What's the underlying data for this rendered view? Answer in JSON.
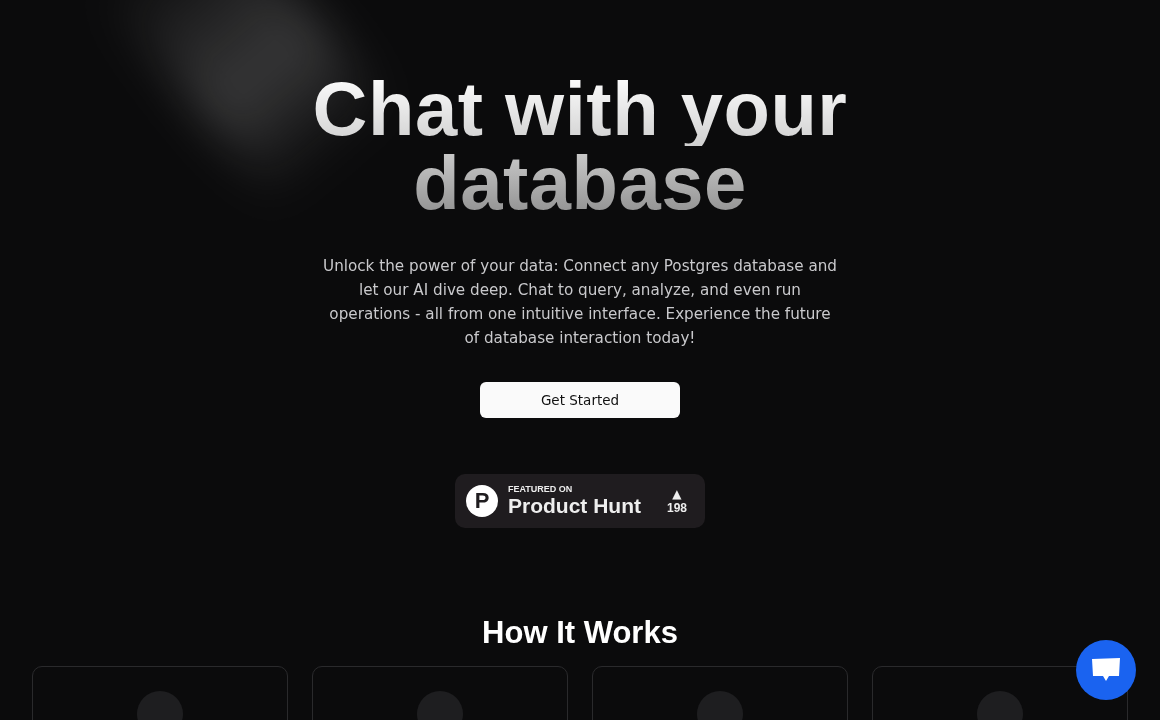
{
  "hero": {
    "title_line_1": "Chat with your",
    "title_line_2": "database",
    "description": "Unlock the power of your data: Connect any Postgres database and let our AI dive deep. Chat to query, analyze, and even run operations - all from one intuitive interface. Experience the future of database interaction today!",
    "cta": "Get Started"
  },
  "product_hunt": {
    "eyebrow": "FEATURED ON",
    "name": "Product Hunt",
    "logo_letter": "P",
    "arrow": "▲",
    "votes": "198"
  },
  "how_it_works": {
    "heading": "How It Works"
  }
}
